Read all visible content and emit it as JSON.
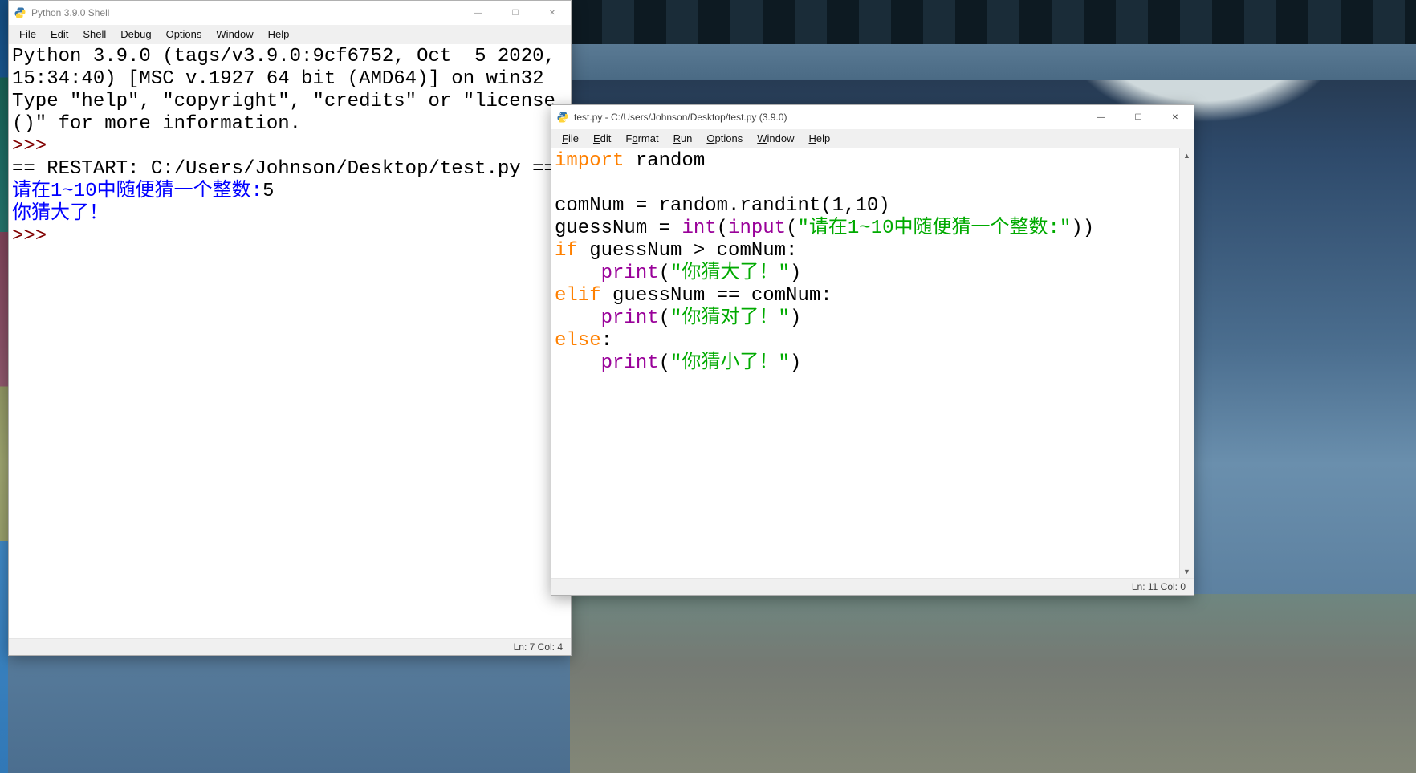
{
  "desktop": {
    "accent": "#3a5a7a"
  },
  "shellWindow": {
    "title": "Python 3.9.0 Shell",
    "menus": [
      "File",
      "Edit",
      "Shell",
      "Debug",
      "Options",
      "Window",
      "Help"
    ],
    "banner_l1": "Python 3.9.0 (tags/v3.9.0:9cf6752, Oct  5 2020,",
    "banner_l2": "15:34:40) [MSC v.1927 64 bit (AMD64)] on win32",
    "banner_l3": "Type \"help\", \"copyright\", \"credits\" or \"license",
    "banner_l4": "()\" for more information.",
    "prompt": ">>> ",
    "restart": "== RESTART: C:/Users/Johnson/Desktop/test.py ==",
    "io_line1_prompt": "请在1~10中随便猜一个整数:",
    "io_line1_input": "5",
    "io_line2": "你猜大了！",
    "status": "Ln: 7  Col: 4"
  },
  "editorWindow": {
    "title": "test.py - C:/Users/Johnson/Desktop/test.py (3.9.0)",
    "menus": [
      "File",
      "Edit",
      "Format",
      "Run",
      "Options",
      "Window",
      "Help"
    ],
    "code": {
      "l1_kw": "import",
      "l1_rest": " random",
      "l3_a": "comNum = random.randint(",
      "l3_b": "1",
      "l3_c": ",",
      "l3_d": "10",
      "l3_e": ")",
      "l4_a": "guessNum = ",
      "l4_int": "int",
      "l4_b": "(",
      "l4_input": "input",
      "l4_c": "(",
      "l4_str": "\"请在1~10中随便猜一个整数:\"",
      "l4_d": "))",
      "l5_if": "if",
      "l5_rest": " guessNum > comNum:",
      "l6_indent": "    ",
      "l6_print": "print",
      "l6_a": "(",
      "l6_str": "\"你猜大了！\"",
      "l6_b": ")",
      "l7_elif": "elif",
      "l7_rest": " guessNum == comNum:",
      "l8_indent": "    ",
      "l8_print": "print",
      "l8_a": "(",
      "l8_str": "\"你猜对了！\"",
      "l8_b": ")",
      "l9_else": "else",
      "l9_rest": ":",
      "l10_indent": "    ",
      "l10_print": "print",
      "l10_a": "(",
      "l10_str": "\"你猜小了！\"",
      "l10_b": ")"
    },
    "status": "Ln: 11  Col: 0"
  },
  "controls": {
    "min": "—",
    "max": "☐",
    "close": "✕",
    "scroll_up": "▲",
    "scroll_down": "▼"
  }
}
